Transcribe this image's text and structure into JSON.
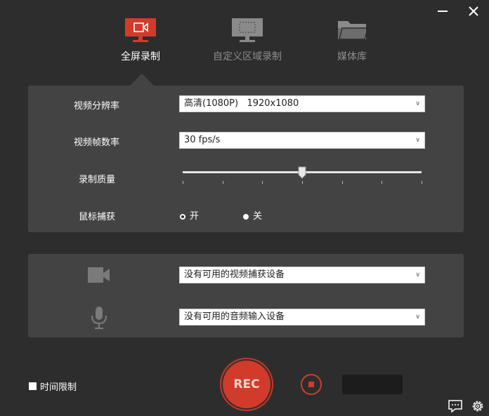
{
  "tabs": [
    {
      "label": "全屏录制",
      "icon": "monitor-record-icon",
      "active": true
    },
    {
      "label": "自定义区域录制",
      "icon": "monitor-region-icon",
      "active": false
    },
    {
      "label": "媒体库",
      "icon": "folder-icon",
      "active": false
    }
  ],
  "settings": {
    "resolution_label": "视频分辨率",
    "resolution_value": "高清(1080P)   1920x1080",
    "framerate_label": "视频帧数率",
    "framerate_value": "30 fps/s",
    "quality_label": "录制质量",
    "quality_level": 0.5,
    "quality_ticks": 7,
    "cursor_label": "鼠标捕获",
    "cursor_on": "开",
    "cursor_off": "关",
    "cursor_selected": "开"
  },
  "devices": {
    "camera_icon": "video-camera-icon",
    "camera_value": "没有可用的视频捕获设备",
    "mic_icon": "microphone-icon",
    "mic_value": "没有可用的音频输入设备"
  },
  "bottom": {
    "time_limit_label": "时间限制",
    "time_limit_checked": false,
    "rec_label": "REC"
  },
  "colors": {
    "accent": "#d23b2b",
    "background": "#2e2d2d",
    "panel": "#444344"
  }
}
